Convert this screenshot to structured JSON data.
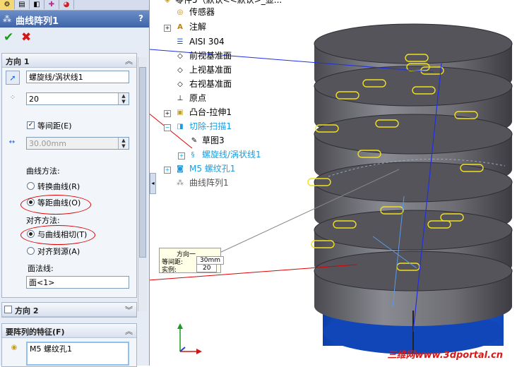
{
  "tabs": [
    "feature-manager-icon",
    "property-manager-icon",
    "configuration-manager-icon",
    "dimxpert-icon",
    "display-manager-icon"
  ],
  "title": "曲线阵列1",
  "help": "?",
  "ok": "✔",
  "cancel": "✖",
  "direction1": {
    "header": "方向 1",
    "curve_value": "螺旋线/涡状线1",
    "count_value": "20",
    "equal_spacing_label": "等间距(E)",
    "spacing_value": "30.00mm",
    "curve_method_label": "曲线方法:",
    "curve_options": [
      "转换曲线(R)",
      "等距曲线(O)"
    ],
    "align_method_label": "对齐方法:",
    "align_options": [
      "与曲线相切(T)",
      "对齐到源(A)"
    ],
    "face_label": "面法线:",
    "face_value": "面<1>"
  },
  "direction2": {
    "header": "方向 2"
  },
  "features": {
    "header": "要阵列的特征(F)",
    "item": "M5 螺纹孔1"
  },
  "tree": {
    "items": [
      {
        "label": "零件5（默认<<默认>_显..."
      },
      {
        "label": "传感器"
      },
      {
        "label": "注解"
      },
      {
        "label": "AISI 304"
      },
      {
        "label": "前视基准面"
      },
      {
        "label": "上视基准面"
      },
      {
        "label": "右视基准面"
      },
      {
        "label": "原点"
      },
      {
        "label": "凸台-拉伸1"
      },
      {
        "label": "切除-扫描1"
      },
      {
        "label": "草图3"
      },
      {
        "label": "螺旋线/涡状线1"
      },
      {
        "label": "M5 螺纹孔1"
      },
      {
        "label": "曲线阵列1"
      }
    ]
  },
  "callout": {
    "title": "方向一",
    "spacing_label": "等间距:",
    "spacing_value": "30mm",
    "instances_label": "实例:",
    "instances_value": "20"
  },
  "watermark": "三维网www.3dportal.cn",
  "colors": {
    "accent": "#3f64a8",
    "highlight": "#1a9de0",
    "annotation": "#dd0000",
    "part_blue": "#1a5fe0",
    "part_gray": "#6e6e74"
  }
}
